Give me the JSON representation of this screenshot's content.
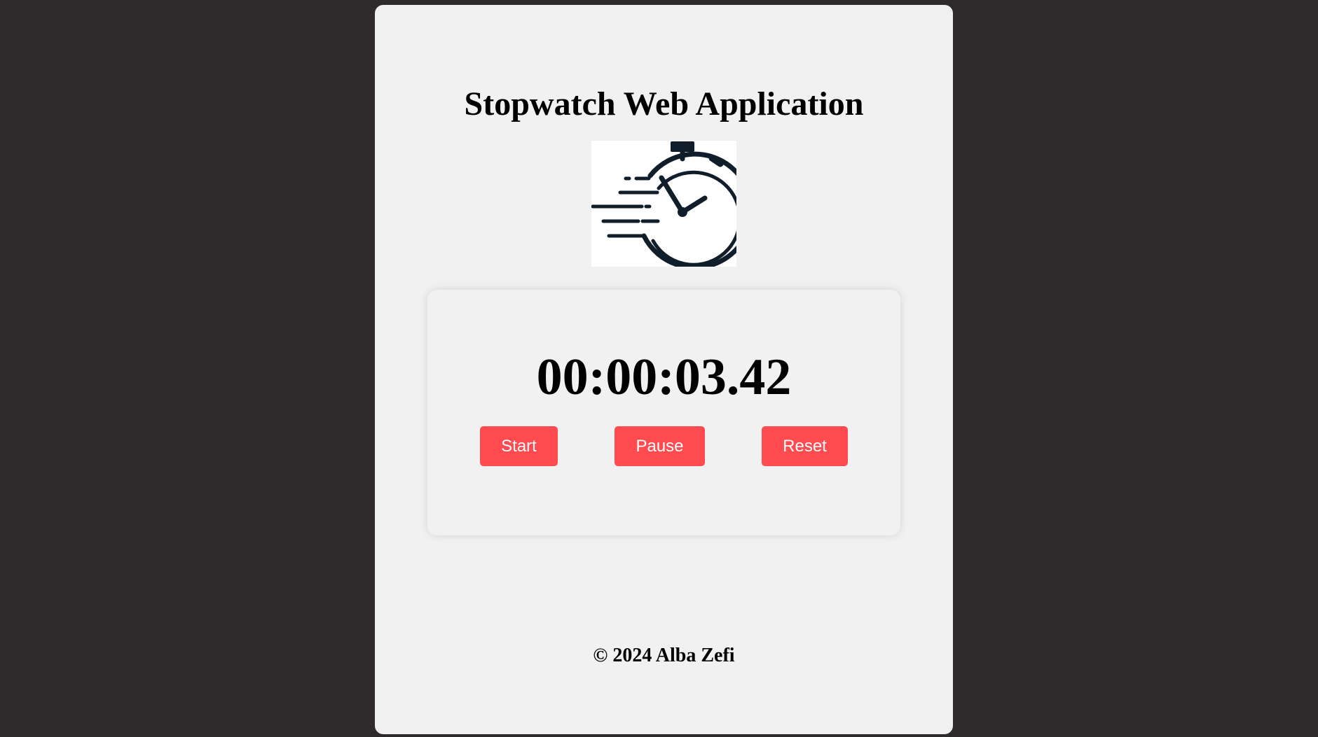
{
  "app": {
    "title": "Stopwatch Web Application",
    "logo_icon": "stopwatch-icon",
    "time_display": "00:00:03.42",
    "footer": "© 2024 Alba Zefi"
  },
  "controls": {
    "start_label": "Start",
    "pause_label": "Pause",
    "reset_label": "Reset"
  },
  "colors": {
    "page_background": "#2f2a2b",
    "card_background": "#f1f1f1",
    "button_background": "#ff4a4f",
    "button_text": "#ffffff",
    "icon_color": "#0f1e2a"
  }
}
